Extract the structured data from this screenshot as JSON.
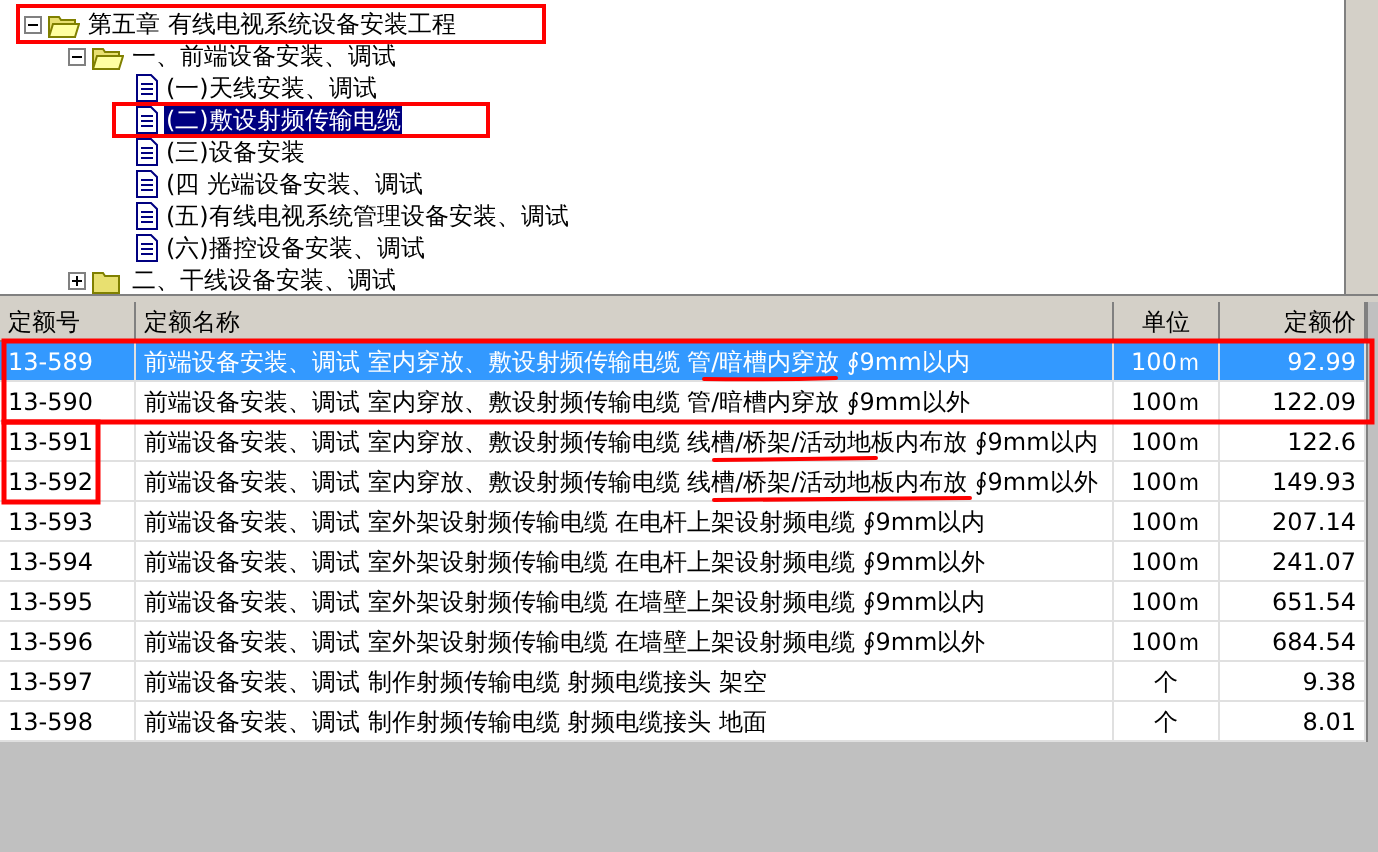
{
  "tree": [
    {
      "label": "第五章 有线电视系统设备安装工程",
      "expanded": true,
      "selected": false,
      "children": [
        {
          "label": "一、前端设备安装、调试",
          "expanded": true,
          "selected": false,
          "children": [
            {
              "label": "(一)天线安装、调试",
              "selected": false
            },
            {
              "label": "(二)敷设射频传输电缆",
              "selected": true
            },
            {
              "label": "(三)设备安装",
              "selected": false
            },
            {
              "label": "(四 光端设备安装、调试",
              "selected": false
            },
            {
              "label": "(五)有线电视系统管理设备安装、调试",
              "selected": false
            },
            {
              "label": "(六)播控设备安装、调试",
              "selected": false
            }
          ]
        },
        {
          "label": "二、干线设备安装、调试",
          "kind": "folder",
          "expanded": false,
          "selected": false
        }
      ]
    }
  ],
  "table": {
    "columns": [
      "定额号",
      "定额名称",
      "单位",
      "定额价"
    ],
    "rows": [
      {
        "cells": [
          "13-589",
          "前端设备安装、调试 室内穿放、敷设射频传输电缆 管/暗槽内穿放 ∮9mm以内",
          "100ｍ",
          "92.99"
        ],
        "selected": true
      },
      {
        "cells": [
          "13-590",
          "前端设备安装、调试 室内穿放、敷设射频传输电缆 管/暗槽内穿放 ∮9mm以外",
          "100ｍ",
          "122.09"
        ],
        "selected": false
      },
      {
        "cells": [
          "13-591",
          "前端设备安装、调试 室内穿放、敷设射频传输电缆 线槽/桥架/活动地板内布放 ∮9mm以内",
          "100ｍ",
          "122.6"
        ],
        "selected": false
      },
      {
        "cells": [
          "13-592",
          "前端设备安装、调试 室内穿放、敷设射频传输电缆 线槽/桥架/活动地板内布放 ∮9mm以外",
          "100ｍ",
          "149.93"
        ],
        "selected": false
      },
      {
        "cells": [
          "13-593",
          "前端设备安装、调试 室外架设射频传输电缆 在电杆上架设射频电缆 ∮9mm以内",
          "100ｍ",
          "207.14"
        ],
        "selected": false
      },
      {
        "cells": [
          "13-594",
          "前端设备安装、调试 室外架设射频传输电缆 在电杆上架设射频电缆 ∮9mm以外",
          "100ｍ",
          "241.07"
        ],
        "selected": false
      },
      {
        "cells": [
          "13-595",
          "前端设备安装、调试 室外架设射频传输电缆 在墙壁上架设射频电缆 ∮9mm以内",
          "100ｍ",
          "651.54"
        ],
        "selected": false
      },
      {
        "cells": [
          "13-596",
          "前端设备安装、调试 室外架设射频传输电缆 在墙壁上架设射频电缆 ∮9mm以外",
          "100ｍ",
          "684.54"
        ],
        "selected": false
      },
      {
        "cells": [
          "13-597",
          "前端设备安装、调试 制作射频传输电缆 射频电缆接头 架空",
          "个",
          "9.38"
        ],
        "selected": false
      },
      {
        "cells": [
          "13-598",
          "前端设备安装、调试 制作射频传输电缆 射频电缆接头 地面",
          "个",
          "8.01"
        ],
        "selected": false
      }
    ]
  }
}
